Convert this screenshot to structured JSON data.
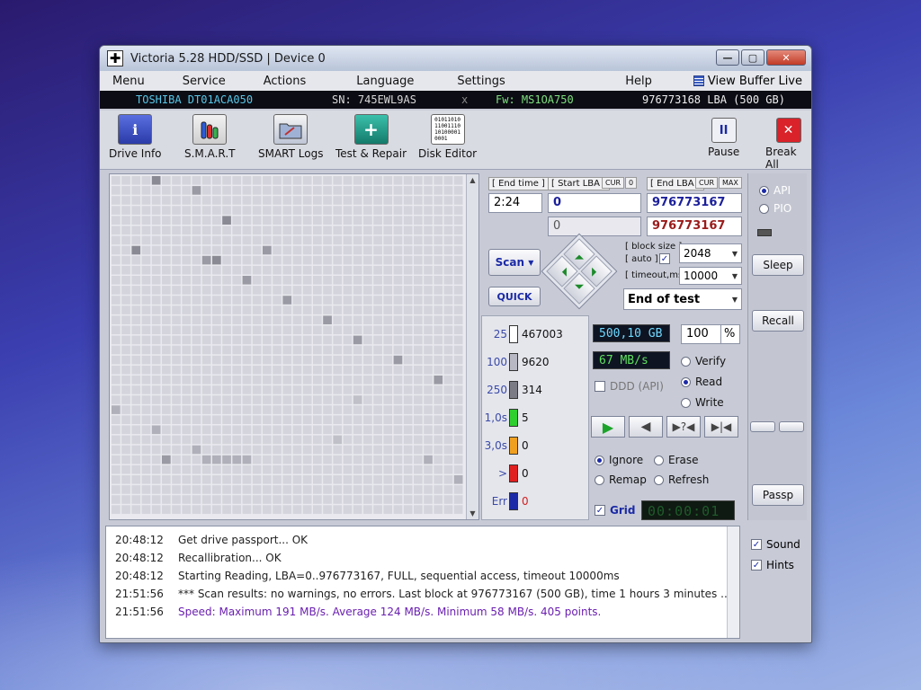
{
  "window": {
    "title": "Victoria 5.28 HDD/SSD | Device 0",
    "icon": "plus-cross-icon"
  },
  "menu": {
    "items": [
      "Menu",
      "Service",
      "Actions",
      "Language",
      "Settings"
    ],
    "help": "Help",
    "view_buffer": "View Buffer Live"
  },
  "drive": {
    "model": "TOSHIBA DT01ACA050",
    "serial": "SN: 745EWL9AS",
    "x": "x",
    "firmware": "Fw: MS1OA750",
    "lba": "976773168 LBA (500 GB)"
  },
  "toolbar": {
    "drive_info": "Drive Info",
    "smart": "S.M.A.R.T",
    "smart_logs": "SMART Logs",
    "test_repair": "Test & Repair",
    "disk_editor": "Disk Editor",
    "pause": "Pause",
    "break_all": "Break All",
    "info_glyph": "i",
    "test_glyph": "+",
    "pause_glyph": "II",
    "break_glyph": "✕",
    "disk_bits": "01011010\n11001110\n10100001\n0001"
  },
  "test": {
    "end_time_label": "[ End time ]",
    "end_time": "2:24",
    "start_lba_label": "[ Start LBA ]",
    "cur": "CUR",
    "zero": "0",
    "end_lba_label": "[ End LBA ]",
    "max": "MAX",
    "start_lba": "0",
    "end_lba": "976773167",
    "current_lba": "0",
    "current_end_lba": "976773167",
    "scan_button": "Scan",
    "quick_button": "QUICK",
    "block_size_label": "[ block size ]",
    "auto_label": "[ auto ]",
    "block_size": "2048",
    "timeout_label": "[ timeout,ms ]",
    "timeout": "10000",
    "end_action": "End of test"
  },
  "stats": {
    "rows": [
      {
        "threshold": "25",
        "count": "467003",
        "color": "#ffffff"
      },
      {
        "threshold": "100",
        "count": "9620",
        "color": "#b8b8c4"
      },
      {
        "threshold": "250",
        "count": "314",
        "color": "#7b7b86"
      },
      {
        "threshold": "1,0s",
        "count": "5",
        "color": "#2fcf2f"
      },
      {
        "threshold": "3,0s",
        "count": "0",
        "color": "#f0a020"
      },
      {
        "threshold": ">",
        "count": "0",
        "color": "#e02020"
      },
      {
        "threshold": "Err",
        "count": "0",
        "color": "#1b2aa6"
      }
    ]
  },
  "progress": {
    "size": "500,10 GB",
    "percent": "100",
    "percent_sign": "%",
    "speed": "67 MB/s",
    "ddd": "DDD (API)"
  },
  "mode": {
    "verify": "Verify",
    "read": "Read",
    "write": "Write",
    "selected": "Read"
  },
  "action": {
    "ignore": "Ignore",
    "erase": "Erase",
    "remap": "Remap",
    "refresh": "Refresh",
    "selected": "Ignore"
  },
  "grid_toggle": "Grid",
  "timer": "00:00:01",
  "side": {
    "api": "API",
    "pio": "PIO",
    "sleep": "Sleep",
    "recall": "Recall",
    "passp": "Passp",
    "sound": "Sound",
    "hints": "Hints"
  },
  "log": [
    {
      "time": "20:48:12",
      "msg": "Get drive passport... OK"
    },
    {
      "time": "20:48:12",
      "msg": "Recallibration... OK"
    },
    {
      "time": "20:48:12",
      "msg": "Starting Reading, LBA=0..976773167, FULL, sequential access, timeout 10000ms"
    },
    {
      "time": "21:51:56",
      "msg": "*** Scan results: no warnings, no errors. Last block at 976773167 (500 GB), time 1 hours 3 minutes ..."
    },
    {
      "time": "21:51:56",
      "msg": "Speed: Maximum 191 MB/s. Average 124 MB/s. Minimum 58 MB/s. 405 points."
    }
  ]
}
